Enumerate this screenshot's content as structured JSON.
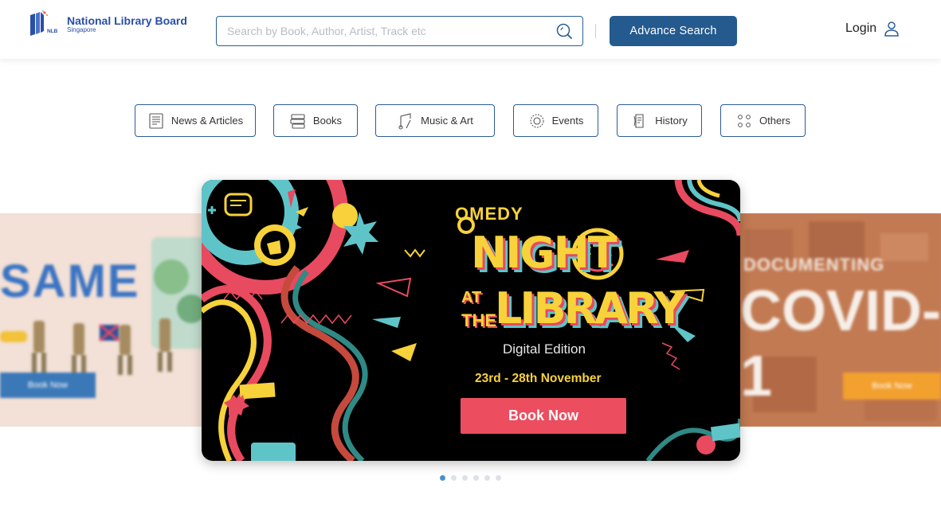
{
  "header": {
    "logo_title": "National Library Board",
    "logo_subtitle": "Singapore",
    "logo_mark_text": "NLB",
    "search_placeholder": "Search by Book, Author, Artist, Track etc",
    "advance_search_label": "Advance Search",
    "login_label": "Login"
  },
  "categories": [
    {
      "label": "News & Articles",
      "icon": "news-icon"
    },
    {
      "label": "Books",
      "icon": "books-icon"
    },
    {
      "label": "Music & Art",
      "icon": "music-art-icon"
    },
    {
      "label": "Events",
      "icon": "events-icon"
    },
    {
      "label": "History",
      "icon": "history-icon"
    },
    {
      "label": "Others",
      "icon": "grid-dots-icon"
    }
  ],
  "carousel": {
    "main": {
      "comedy": "OMEDY",
      "night": "NIGHT",
      "at": "AT",
      "the": "THE",
      "library": "LIBRARY",
      "edition": "Digital Edition",
      "dates": "23rd - 28th November",
      "cta": "Book Now"
    },
    "left": {
      "headline": "SAME",
      "cta": "Book Now"
    },
    "right": {
      "kicker": "DOCUMENTING",
      "headline": "COVID-1",
      "cta": "Book Now"
    },
    "dot_count": 6,
    "active_dot": 0
  },
  "colors": {
    "brand_blue": "#245a8d",
    "accent_red": "#ec4d5f",
    "accent_yellow": "#f7d23a",
    "accent_teal": "#5fc4c8"
  }
}
